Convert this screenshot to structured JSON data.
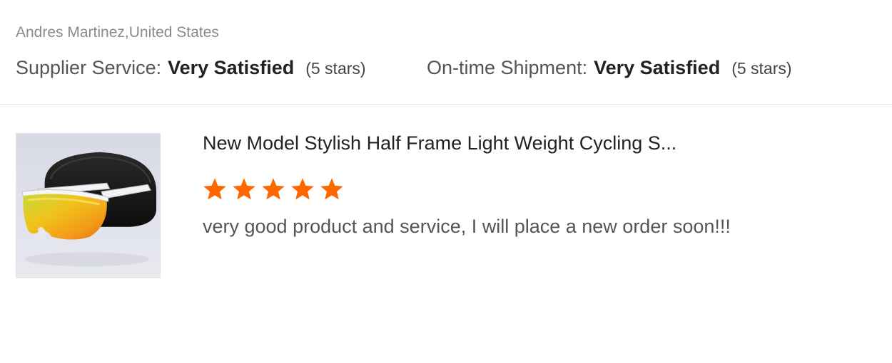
{
  "reviewer": {
    "name_location": "Andres Martinez,United States"
  },
  "ratings": {
    "supplier_service": {
      "label": "Supplier Service:",
      "value": "Very Satisfied",
      "stars_text": "(5 stars)"
    },
    "on_time_shipment": {
      "label": "On-time Shipment:",
      "value": "Very Satisfied",
      "stars_text": "(5 stars)"
    }
  },
  "product": {
    "title": "New Model Stylish Half Frame Light Weight Cycling S...",
    "image_icon": "sunglasses-product-photo",
    "star_rating": 5,
    "star_max": 5,
    "star_color": "#ff6600",
    "review_text": "very good product and service, I will place a new order soon!!!"
  }
}
